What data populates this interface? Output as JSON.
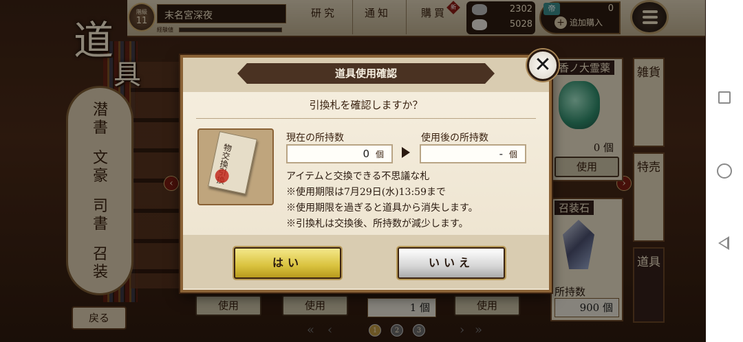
{
  "screen": {
    "title_char1": "道",
    "title_char2": "具"
  },
  "player": {
    "level_label": "階級",
    "level": "11",
    "name": "末名宮深夜",
    "exp_label": "経験値"
  },
  "top_menu": {
    "research": "研究",
    "notice": "通知",
    "purchase": "購買",
    "new_badge": "新"
  },
  "resources": {
    "res1": "2302",
    "res2": "5028"
  },
  "tickets": {
    "icon_text": "帝",
    "count": "0",
    "add_purchase": "追加購入"
  },
  "categories": [
    {
      "label": "潜書"
    },
    {
      "label": "文豪"
    },
    {
      "label": "司書"
    },
    {
      "label": "召装"
    }
  ],
  "back_label": "戻る",
  "side_tabs": [
    {
      "label": "雑貨"
    },
    {
      "label": "特売"
    },
    {
      "label": "道具"
    }
  ],
  "background_items": {
    "top_right_title": "香ノ大霊薬",
    "top_right_count": "0 個",
    "top_right_use": "使用",
    "mid_right_title": "召装石",
    "mid_right_count_label": "所持数",
    "mid_right_count": "900 個",
    "bottom_use_1": "使用",
    "bottom_use_2": "使用",
    "bottom_count": "1 個",
    "bottom_use_3": "使用",
    "pages": [
      "1",
      "2",
      "3"
    ]
  },
  "dialog": {
    "title": "道具使用確認",
    "question": "引換札を確認しますか？",
    "current_label": "現在の所持数",
    "after_label": "使用後の所持数",
    "current_value": "0",
    "after_value": "-",
    "unit": "個",
    "item_image_text": "物交換引換",
    "desc_lines": [
      "アイテムと交換できる不思議な札",
      "※使用期限は7月29日(水)13:59まで",
      "※使用期限を過ぎると道具から消失します。",
      "※引換札は交換後、所持数が減少します。"
    ],
    "yes": "はい",
    "no": "いいえ",
    "close": "✕"
  },
  "colors": {
    "yes_button": "#d9c23e",
    "no_button": "#d6d6d6",
    "dialog_bg": "#f6efe0",
    "title_bar": "#4a3222"
  }
}
